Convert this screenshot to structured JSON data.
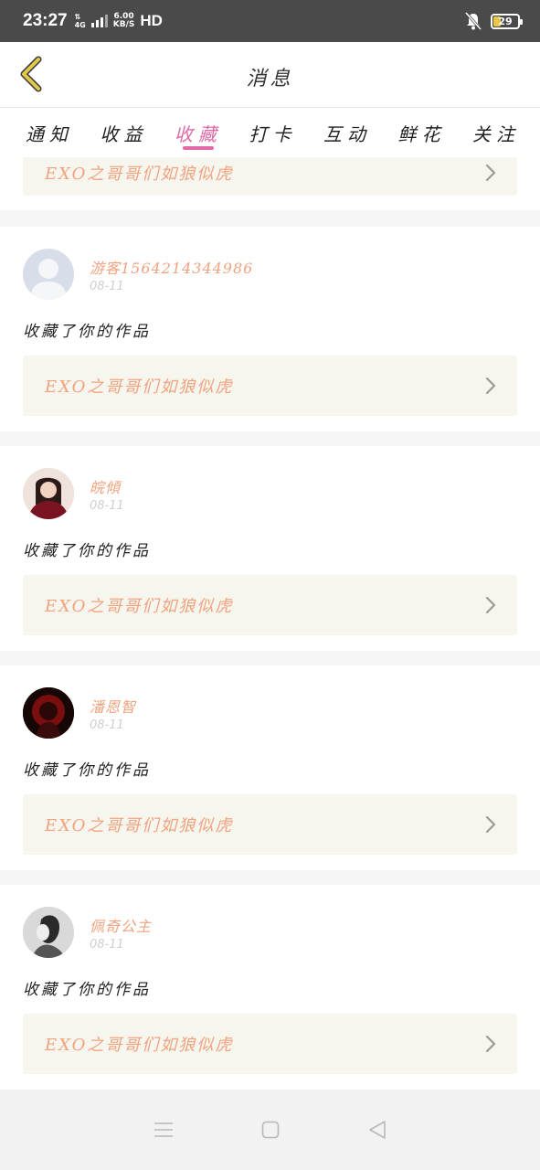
{
  "status_bar": {
    "time": "23:27",
    "network": "4G",
    "speed_value": "6.00",
    "speed_unit": "KB/S",
    "hd": "HD",
    "battery": "29"
  },
  "header": {
    "title": "消息"
  },
  "tabs": [
    {
      "label": "通知",
      "active": false
    },
    {
      "label": "收益",
      "active": false
    },
    {
      "label": "收藏",
      "active": true
    },
    {
      "label": "打卡",
      "active": false
    },
    {
      "label": "互动",
      "active": false
    },
    {
      "label": "鲜花",
      "active": false
    },
    {
      "label": "关注",
      "active": false
    }
  ],
  "feed": {
    "partial_item": {
      "work_title": "EXO之哥哥们如狼似虎"
    },
    "items": [
      {
        "user": "游客1564214344986",
        "date": "08-11",
        "action": "收藏了你的作品",
        "work_title": "EXO之哥哥们如狼似虎",
        "avatar": "default-avatar"
      },
      {
        "user": "皖傾",
        "date": "08-11",
        "action": "收藏了你的作品",
        "work_title": "EXO之哥哥们如狼似虎",
        "avatar": "photo-girl-red"
      },
      {
        "user": "潘恩智",
        "date": "08-11",
        "action": "收藏了你的作品",
        "work_title": "EXO之哥哥们如狼似虎",
        "avatar": "photo-dark-red"
      },
      {
        "user": "佩奇公主",
        "date": "08-11",
        "action": "收藏了你的作品",
        "work_title": "EXO之哥哥们如狼似虎",
        "avatar": "photo-bw-profile"
      }
    ]
  },
  "colors": {
    "accent": "#e06aa6",
    "name": "#f0a37e",
    "work_box": "#f6f5ee",
    "back_icon": "#e2c94c"
  },
  "nav_bar": [
    "menu-icon",
    "home-icon",
    "back-triangle-icon"
  ]
}
